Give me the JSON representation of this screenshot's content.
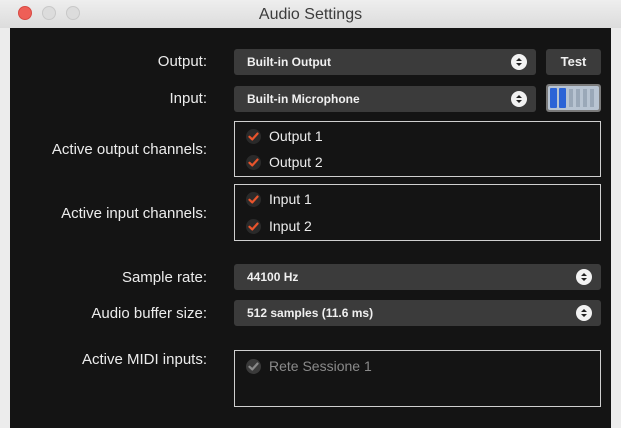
{
  "window": {
    "title": "Audio Settings"
  },
  "output": {
    "label": "Output:",
    "value": "Built-in Output",
    "test_button": "Test"
  },
  "input": {
    "label": "Input:",
    "value": "Built-in Microphone",
    "level_fraction": 0.2
  },
  "active_output_channels": {
    "label": "Active output channels:",
    "items": [
      {
        "label": "Output 1",
        "checked": true
      },
      {
        "label": "Output 2",
        "checked": true
      }
    ]
  },
  "active_input_channels": {
    "label": "Active input channels:",
    "items": [
      {
        "label": "Input 1",
        "checked": true
      },
      {
        "label": "Input 2",
        "checked": true
      }
    ]
  },
  "sample_rate": {
    "label": "Sample rate:",
    "value": "44100 Hz"
  },
  "buffer_size": {
    "label": "Audio buffer size:",
    "value": "512 samples (11.6 ms)"
  },
  "midi_inputs": {
    "label": "Active MIDI inputs:",
    "items": [
      {
        "label": "Rete Sessione 1",
        "checked": false
      }
    ]
  },
  "colors": {
    "panel_background": "#141414",
    "check_accent": "#e8542c",
    "meter_level": "#2b63d6"
  }
}
